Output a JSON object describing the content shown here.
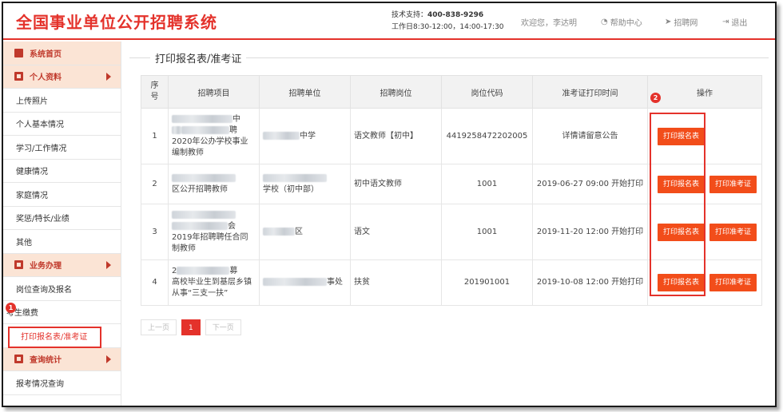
{
  "header": {
    "logo": "全国事业单位公开招聘系统",
    "support_label": "技术支持：",
    "support_phone": "400-838-9296",
    "hours": "工作日8:30-12:00，14:00-17:30",
    "welcome": "欢迎您，李达明",
    "help": "帮助中心",
    "recruit": "招聘网",
    "logout": "退出"
  },
  "sidebar": {
    "home": "系统首页",
    "profile_head": "个人资料",
    "profile_items": [
      "上传照片",
      "个人基本情况",
      "学习/工作情况",
      "健康情况",
      "家庭情况",
      "奖惩/特长/业绩",
      "其他"
    ],
    "business_head": "业务办理",
    "business_items": [
      "岗位查询及报名",
      "考生缴费",
      "打印报名表/准考证"
    ],
    "query_head": "查询统计",
    "query_items": [
      "报考情况查询"
    ]
  },
  "main": {
    "title": "打印报名表/准考证",
    "columns": [
      "序号",
      "招聘项目",
      "招聘单位",
      "招聘岗位",
      "岗位代码",
      "准考证打印时间",
      "操作"
    ],
    "rows": [
      {
        "no": "1",
        "project_a": "中",
        "project_b": "聘",
        "project_c": "2020年公办学校事业编制教师",
        "unit": "中学",
        "post": "语文教师【初中】",
        "code": "4419258472202005",
        "time": "详情请留意公告",
        "btn1": "打印报名表",
        "btn2": ""
      },
      {
        "no": "2",
        "project_a": "",
        "project_b": "",
        "project_c": "区公开招聘教师",
        "unit": "学校（初中部）",
        "post": "初中语文教师",
        "code": "1001",
        "time": "2019-06-27 09:00 开始打印",
        "btn1": "打印报名表",
        "btn2": "打印准考证"
      },
      {
        "no": "3",
        "project_a": "",
        "project_b": "会",
        "project_c": "2019年招聘聘任合同制教师",
        "unit": "区",
        "post": "语文",
        "code": "1001",
        "time": "2019-11-20 12:00 开始打印",
        "btn1": "打印报名表",
        "btn2": "打印准考证"
      },
      {
        "no": "4",
        "project_a": "2",
        "project_b": "募",
        "project_c": "高校毕业生到基层乡镇从事“三支一扶”",
        "unit": "事处",
        "post": "扶贫",
        "code": "201901001",
        "time": "2019-10-08 12:00 开始打印",
        "btn1": "打印报名表",
        "btn2": "打印准考证"
      }
    ]
  },
  "pager": {
    "prev": "上一页",
    "current": "1",
    "next": "下一页"
  },
  "badges": {
    "one": "1",
    "two": "2"
  },
  "colors": {
    "accent": "#e4322b",
    "button": "#f24d1a",
    "sidebar_head_bg": "#fbe4d5"
  }
}
